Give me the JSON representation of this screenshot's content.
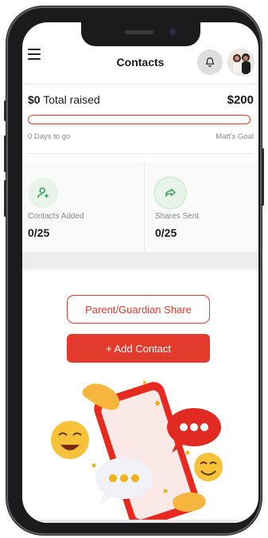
{
  "header": {
    "title": "Contacts",
    "menu_icon": "hamburger-menu-icon",
    "bell_icon": "bell-icon"
  },
  "fundraising": {
    "raised_amount": "$0",
    "raised_label": "Total raised",
    "goal_amount": "$200",
    "progress_fraction": 0,
    "days_to_go": "0 Days to go",
    "goal_label": "Matt's Goal"
  },
  "stats": [
    {
      "label": "Contacts Added",
      "value": "0/25",
      "icon": "add-contact-icon"
    },
    {
      "label": "Shares Sent",
      "value": "0/25",
      "icon": "share-arrow-icon"
    }
  ],
  "actions": {
    "parent_share": "Parent/Guardian Share",
    "add_contact": "+ Add Contact"
  },
  "colors": {
    "accent": "#e23b30",
    "icon_green": "#2f9e52",
    "icon_bg": "#e8f4ea"
  }
}
